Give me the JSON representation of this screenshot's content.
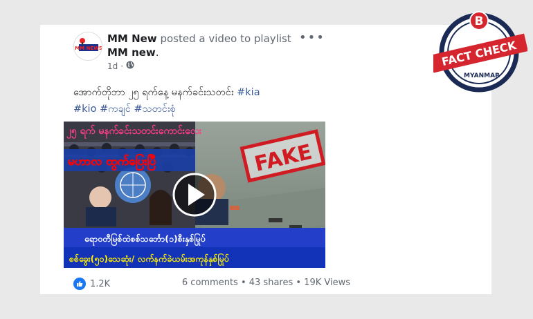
{
  "post": {
    "author": "MM New",
    "action": "posted a video to playlist",
    "playlist": "MM new",
    "period": ".",
    "time": "1d",
    "time_sep": "·",
    "more": "•••",
    "caption_text": "အောက်တိုဘာ ၂၅ ရက်နေ့ မနက်ခင်းသတင်း",
    "tags": [
      "#kia",
      "#kio",
      "#ကချင်",
      "#သတင်းစုံ"
    ]
  },
  "video": {
    "top_text": "၂၅ ရက်  မနက်ခင်းသတင်းကောင်းလေး",
    "headline": "မဟာလ ထွက်ပြေးပြီ",
    "fake_stamp": "FAKE",
    "banner1": "ရောဝတီမြစ်ထဲစစ်သင်္ဘော(၁)စီးနှစ်မြုပ်",
    "banner2": "စစ်ခွေး(၅၀)သေဆုံး/ လက်နက်ခဲယမ်းအကုန်နှစ်မြုပ်"
  },
  "footer": {
    "likes": "1.2K",
    "stats": "6 comments • 43 shares • 19K Views"
  },
  "badge": {
    "letter": "B",
    "title": "FACT CHECK",
    "subtitle": "MYANMAR"
  },
  "avatar": {
    "text": "MM NEWS"
  },
  "colors": {
    "accent": "#385898",
    "stamp": "#d11b22",
    "like": "#1877f2",
    "badge_red": "#d5262f"
  }
}
